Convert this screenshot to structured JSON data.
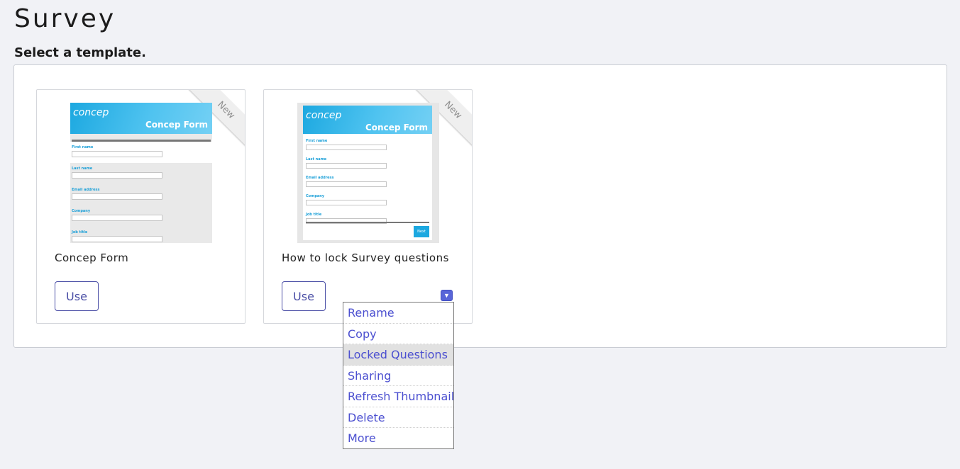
{
  "page": {
    "title": "Survey",
    "subtitle": "Select a template."
  },
  "templates": [
    {
      "name": "Concep Form",
      "badge": "New",
      "use_label": "Use",
      "thumbnail": {
        "logo": "concep",
        "heading": "Concep Form",
        "fields": [
          "First name",
          "Last name",
          "Email address",
          "Company",
          "Job title"
        ]
      }
    },
    {
      "name": "How to lock Survey questions",
      "badge": "New",
      "use_label": "Use",
      "thumbnail": {
        "logo": "concep",
        "heading": "Concep Form",
        "fields": [
          "First name",
          "Last name",
          "Email address",
          "Company",
          "Job title"
        ],
        "button": "Next"
      }
    }
  ],
  "dropdown_menu": {
    "items": [
      "Rename",
      "Copy",
      "Locked Questions",
      "Sharing",
      "Refresh Thumbnail",
      "Delete",
      "More"
    ],
    "highlighted": "Locked Questions"
  },
  "colors": {
    "accent": "#4b4fa6",
    "menu_link": "#4b4fd0",
    "toggle": "#5865d8",
    "thumbnail_header": "#1ca8e0",
    "background": "#f1f2f6"
  },
  "icons": {
    "dropdown_toggle": "caret-down-icon"
  }
}
